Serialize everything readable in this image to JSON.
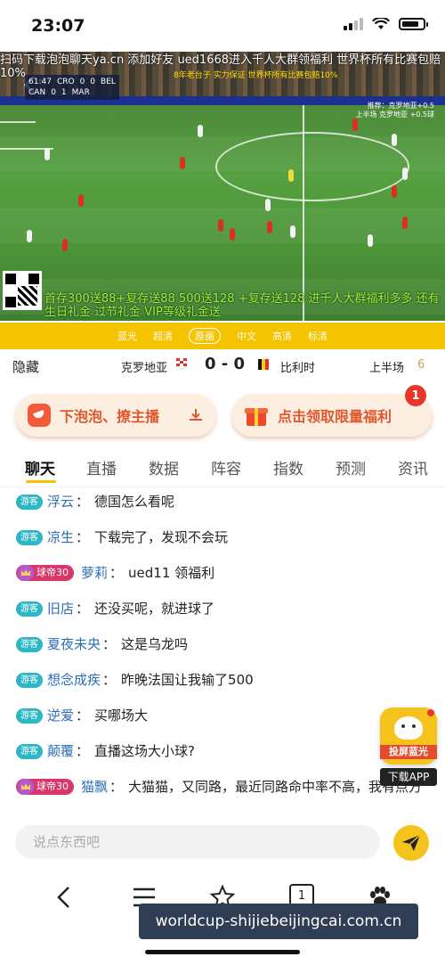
{
  "status_bar": {
    "time": "23:07",
    "signal_icon": "cellular-signal-icon",
    "wifi_icon": "wifi-icon",
    "battery_icon": "battery-icon",
    "battery_level": 0.75
  },
  "video": {
    "ad_top_line1": "扫码下载泡泡聊天ya.cn 添加好友 ued1668进入千人大群领福利 世界杯所有比赛包赔",
    "ad_top_line2": "10%",
    "scoreboard": {
      "clock": "61:47",
      "home": "CRO",
      "home_score": "0",
      "away_score": "0",
      "away": "BEL",
      "row2_home": "CAN",
      "row2_home_score": "0",
      "row2_away_score": "1",
      "row2_away": "MAR"
    },
    "promo_small": "8年老台子 实力保证 世界杯所有比赛包赔10%",
    "promo_small_right_1": "推荐：克罗地亚+0.5",
    "promo_small_right_2": "上半场 克罗地亚 +0.5球",
    "ad_bottom": "首存300送88+复存送88 500送128 +复存送128 进千人大群福利多多 还有生日礼金 过节礼金 VIP等级礼金送"
  },
  "quality_bar": {
    "options": [
      "蓝光",
      "超清",
      "原画",
      "中文",
      "高清",
      "标清"
    ],
    "active_index": 2
  },
  "match": {
    "hide_label": "隐藏",
    "team_home": "克罗地亚",
    "score": "0 - 0",
    "team_away": "比利时",
    "period": "上半场",
    "period_num": "6"
  },
  "actions": {
    "left_label": "下泡泡、撩主播",
    "right_label": "点击领取限量福利",
    "badge_count": "1"
  },
  "tabs": [
    "聊天",
    "直播",
    "数据",
    "阵容",
    "指数",
    "预测",
    "资讯"
  ],
  "active_tab": 0,
  "chat": [
    {
      "tag": "游客",
      "vip": false,
      "name": "浮云",
      "text": "德国怎么看呢"
    },
    {
      "tag": "游客",
      "vip": false,
      "name": "凉生",
      "text": "下载完了，发现不会玩"
    },
    {
      "tag": "球帝30",
      "vip": true,
      "name": "萝莉",
      "text": "ued11 领福利"
    },
    {
      "tag": "游客",
      "vip": false,
      "name": "旧店",
      "text": "还没买呢，就进球了"
    },
    {
      "tag": "游客",
      "vip": false,
      "name": "夏夜未央",
      "text": "这是乌龙吗"
    },
    {
      "tag": "游客",
      "vip": false,
      "name": "想念成疾",
      "text": "昨晚法国让我输了500"
    },
    {
      "tag": "游客",
      "vip": false,
      "name": "逆爱",
      "text": "买哪场大"
    },
    {
      "tag": "游客",
      "vip": false,
      "name": "颠覆",
      "text": "直播这场大小球?"
    },
    {
      "tag": "球帝30",
      "vip": true,
      "name": "猫飘",
      "text": "大猫猫，又同路，最近同路命中率不高，我有点方"
    }
  ],
  "cast": {
    "label": "投屏蓝光",
    "download": "下载APP"
  },
  "input": {
    "placeholder": "说点东西吧"
  },
  "toolbar": {
    "tab_count": "1"
  },
  "watermark": "worldcup-shijiebeijingcai.com.cn"
}
